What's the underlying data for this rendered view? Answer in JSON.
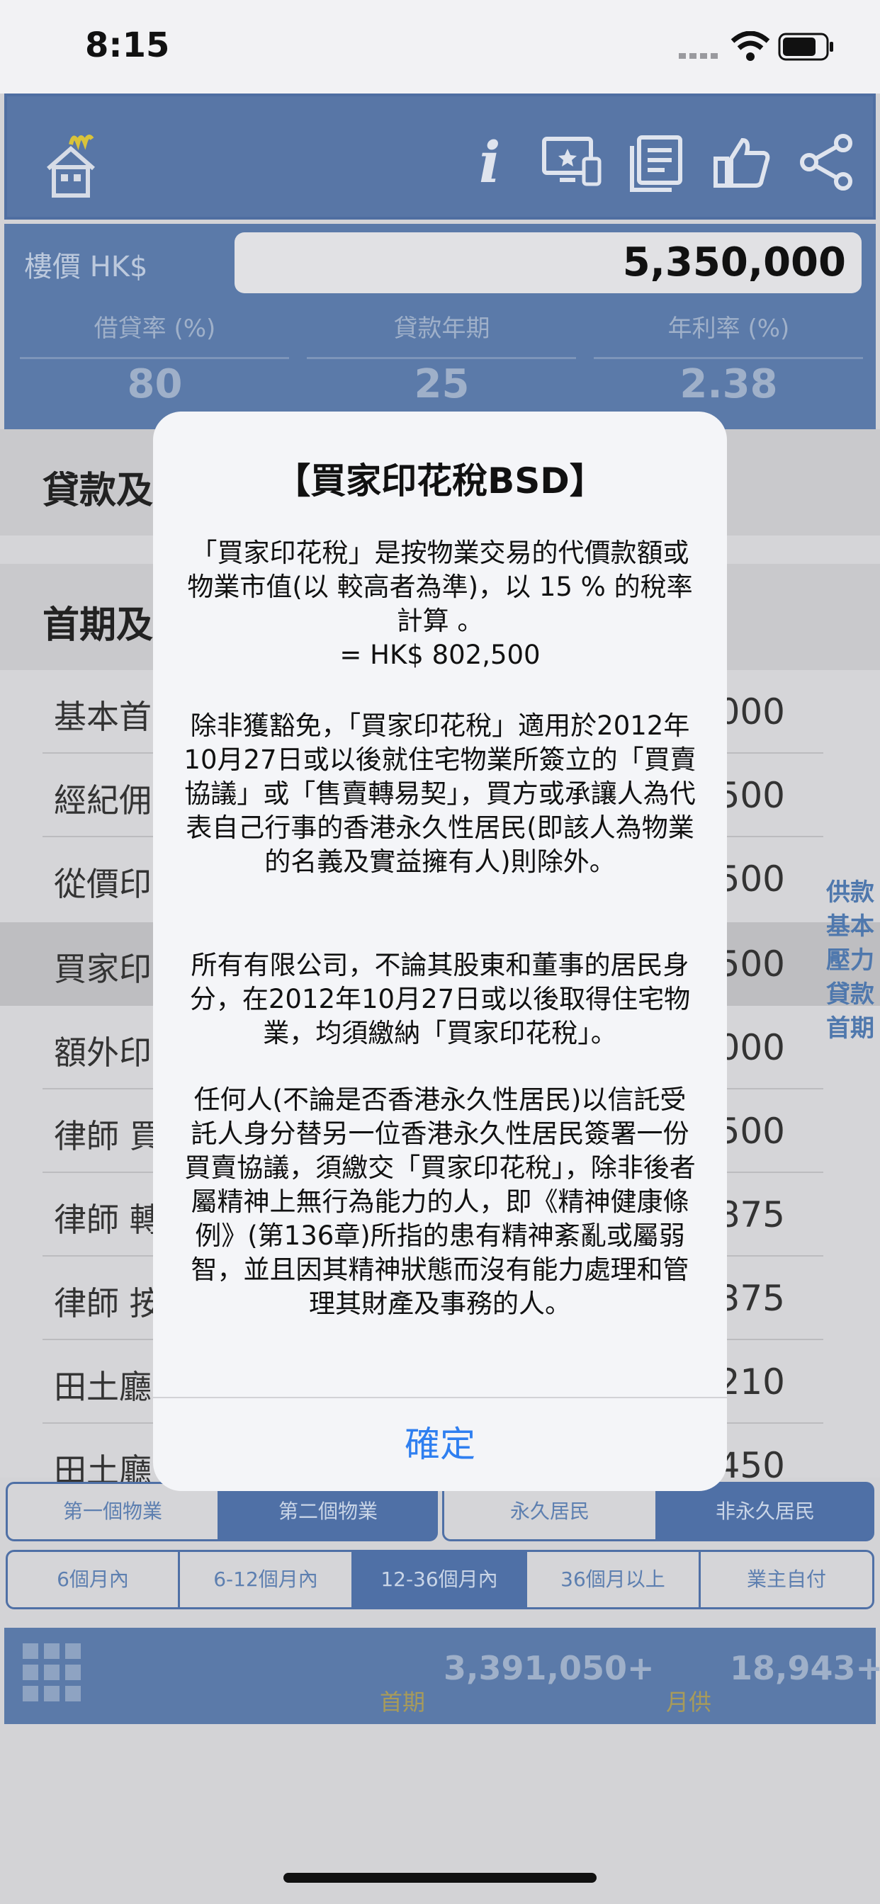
{
  "status_bar": {
    "time": "8:15"
  },
  "toolbar": {
    "icons": [
      "home-icon",
      "info-icon",
      "presentation-icon",
      "document-icon",
      "thumbs-up-icon",
      "share-icon"
    ],
    "info_glyph": "i"
  },
  "price": {
    "label": "樓價 HK$",
    "value": "5,350,000",
    "params": [
      {
        "label": "借貸率 (%)",
        "value": "80"
      },
      {
        "label": "貸款年期",
        "value": "25"
      },
      {
        "label": "年利率 (%)",
        "value": "2.38"
      }
    ]
  },
  "sections": [
    {
      "title": "貸款及"
    },
    {
      "title": "首期及"
    }
  ],
  "rows": [
    {
      "label": "基本首",
      "value": "000"
    },
    {
      "label": "經紀佣",
      "value": "500"
    },
    {
      "label": "從價印",
      "value": "500"
    },
    {
      "label": "買家印",
      "value": "500"
    },
    {
      "label": "額外印",
      "value": "000"
    },
    {
      "label": "律師 買",
      "value": "500"
    },
    {
      "label": "律師 轉",
      "value": "875"
    },
    {
      "label": "律師 按",
      "value": "375"
    },
    {
      "label": "田土廳",
      "value": "210"
    },
    {
      "label": "田土廳",
      "value": "450"
    }
  ],
  "side_links": [
    "供款",
    "基本",
    "壓力",
    "貸款",
    "首期"
  ],
  "segments_property": [
    "第一個物業",
    "第二個物業",
    "永久居民",
    "非永久居民"
  ],
  "segments_period": [
    "6個月內",
    "6-12個月內",
    "12-36個月內",
    "36個月以上",
    "業主自付"
  ],
  "bottom": {
    "down_value": "3,391,050+",
    "down_label": "首期",
    "monthly_value": "18,943+",
    "monthly_label": "月供"
  },
  "alert": {
    "title": "【買家印花稅BSD】",
    "paragraphs": [
      "「買家印花稅」是按物業交易的代價款額或物業市值(以 較高者為準)，以 15 % 的稅率計算 。\n= HK$ 802,500",
      "除非獲豁免，「買家印花稅」適用於2012年10月27日或以後就住宅物業所簽立的「買賣協議」或「售賣轉易契」，買方或承讓人為代表自己行事的香港永久性居民(即該人為物業的名義及實益擁有人)則除外。",
      "所有有限公司，不論其股東和董事的居民身分，在2012年10月27日或以後取得住宅物業，均須繳納「買家印花稅」。",
      "任何人(不論是否香港永久性居民)以信託受託人身分替另一位香港永久性居民簽署一份買賣協議，須繳交「買家印花稅」，除非後者屬精神上無行為能力的人，即《精神健康條例》(第136章)所指的患有精神紊亂或屬弱智，並且因其精神狀態而沒有能力處理和管理其財產及事務的人。"
    ],
    "ok_label": "確定"
  }
}
